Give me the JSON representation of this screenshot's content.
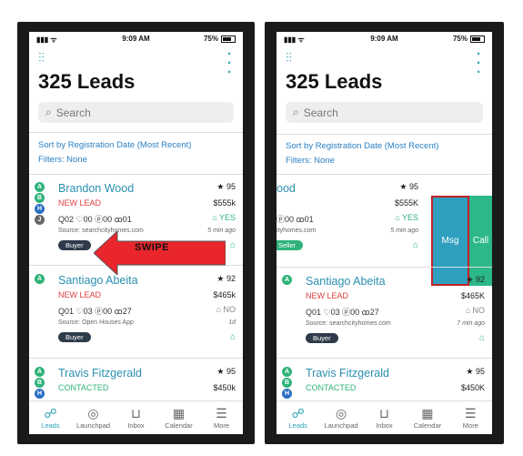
{
  "status_bar": {
    "time": "9:09 AM",
    "battery": "75%"
  },
  "header": {
    "title": "325 Leads"
  },
  "search": {
    "placeholder": "Search"
  },
  "sort": {
    "label": "Sort by Registration Date (Most Recent)",
    "filters": "Filters: None"
  },
  "overlay": {
    "swipe_label": "SWIPE",
    "msg_label": "Msg",
    "call_label": "Call"
  },
  "left_leads": [
    {
      "name": "Brandon Wood",
      "status": "NEW LEAD",
      "counts": "Q02  ♡00  ⓟ00  ꝏ01",
      "source": "Source: searchcityhomes.com",
      "badge": "Buyer",
      "rating": "★ 95",
      "price": "$555k",
      "flag": "⌂ YES",
      "time": "5 min ago",
      "avatars": [
        "A",
        "B",
        "H",
        "J"
      ]
    },
    {
      "name": "Santiago Abeita",
      "status": "NEW LEAD",
      "counts": "Q01  ♡03  ⓟ00  ꝏ27",
      "source": "Source: Open Houses App",
      "badge": "Buyer",
      "rating": "★ 92",
      "price": "$465k",
      "flag": "⌂ NO",
      "time": "1d",
      "avatars": [
        "A"
      ]
    },
    {
      "name": "Travis Fitzgerald",
      "status": "CONTACTED",
      "counts": "",
      "source": "",
      "badge": "",
      "rating": "★ 95",
      "price": "$450k",
      "flag": "",
      "time": "",
      "avatars": [
        "A",
        "B",
        "H"
      ]
    }
  ],
  "right_leads": [
    {
      "name": "ood",
      "status": "",
      "counts": "ⓟ00  ꝏ01",
      "source": "ityhomes.com",
      "badge": "Seller",
      "rating": "★ 95",
      "price": "$555K",
      "flag": "⌂ YES",
      "time": "5 min ago"
    },
    {
      "name": "Santiago Abeita",
      "status": "NEW LEAD",
      "counts": "Q01  ♡03  ⓟ00  ꝏ27",
      "source": "Source: searchcityhomes.com",
      "badge": "Buyer",
      "rating": "★ 92",
      "price": "$465K",
      "flag": "⌂ NO",
      "time": "7 min ago"
    },
    {
      "name": "Travis Fitzgerald",
      "status": "CONTACTED",
      "rating": "★ 95",
      "price": "$450K"
    }
  ],
  "tabs": [
    {
      "label": "Leads",
      "icon": "people-icon"
    },
    {
      "label": "Launchpad",
      "icon": "dial-icon"
    },
    {
      "label": "Inbox",
      "icon": "inbox-icon"
    },
    {
      "label": "Calendar",
      "icon": "calendar-icon"
    },
    {
      "label": "More",
      "icon": "menu-icon"
    }
  ],
  "colors": {
    "accent": "#2aa3b5",
    "new_lead": "#e03c3c",
    "contacted": "#2fb37a",
    "msg": "#2e9fbf",
    "call": "#2cb88a",
    "arrow": "#e8262b"
  }
}
